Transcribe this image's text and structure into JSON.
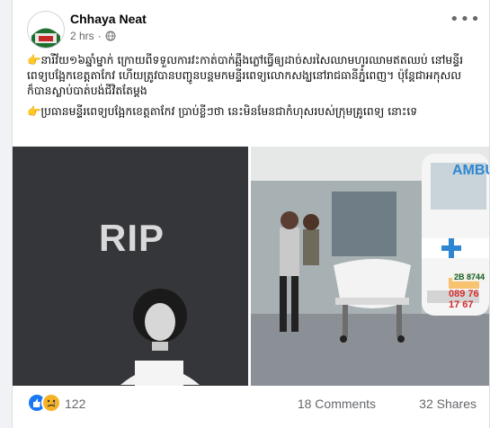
{
  "post": {
    "author": "Chhaya Neat",
    "time": "2 hrs",
    "dot": "·",
    "paragraphs": [
      "👉នារីវ័យ១៦ឆ្នាំម្នាក់ ក្រោយពីទទួលការវះកាត់បាក់ឆ្អឹងភ្លៅធ្វើឲ្យដាច់សរសៃឈាមហូរឈាមឥតឈប់ នៅមន្ទីរពេទ្យបង្អែកខេត្តតាកែវ ហើយត្រូវបានបញ្ជូនបន្តមកមន្ទីរពេទ្យលោកសង្ឃនៅរាជធានីភ្នំពេញ។ ប៉ុន្តែជាអកុសលក៏បានស្លាប់បាត់បង់ជីវិតតែម្តង",
      "👉ប្រធានមន្ទីរពេទ្យបង្អែកខេត្តតាកែវ ប្រាប់ខ្លីៗថា នេះមិនមែនជាកំហុសរបស់ក្រុមគ្រូពេទ្យ នោះទេ"
    ],
    "photo_left_text": "RIP",
    "photo_right_text": {
      "ambulance": "AMBU",
      "phone": "089 76 17 67",
      "plate": "2B 8744"
    },
    "reactions_count": "122",
    "comments": "18 Comments",
    "shares": "32 Shares"
  },
  "icons": [
    "more-icon",
    "globe-icon",
    "like-reaction-icon",
    "sad-reaction-icon"
  ],
  "colors": {
    "accent": "#1877f2",
    "sad": "#f7b125",
    "text": "#050505",
    "secondary": "#65676b"
  }
}
